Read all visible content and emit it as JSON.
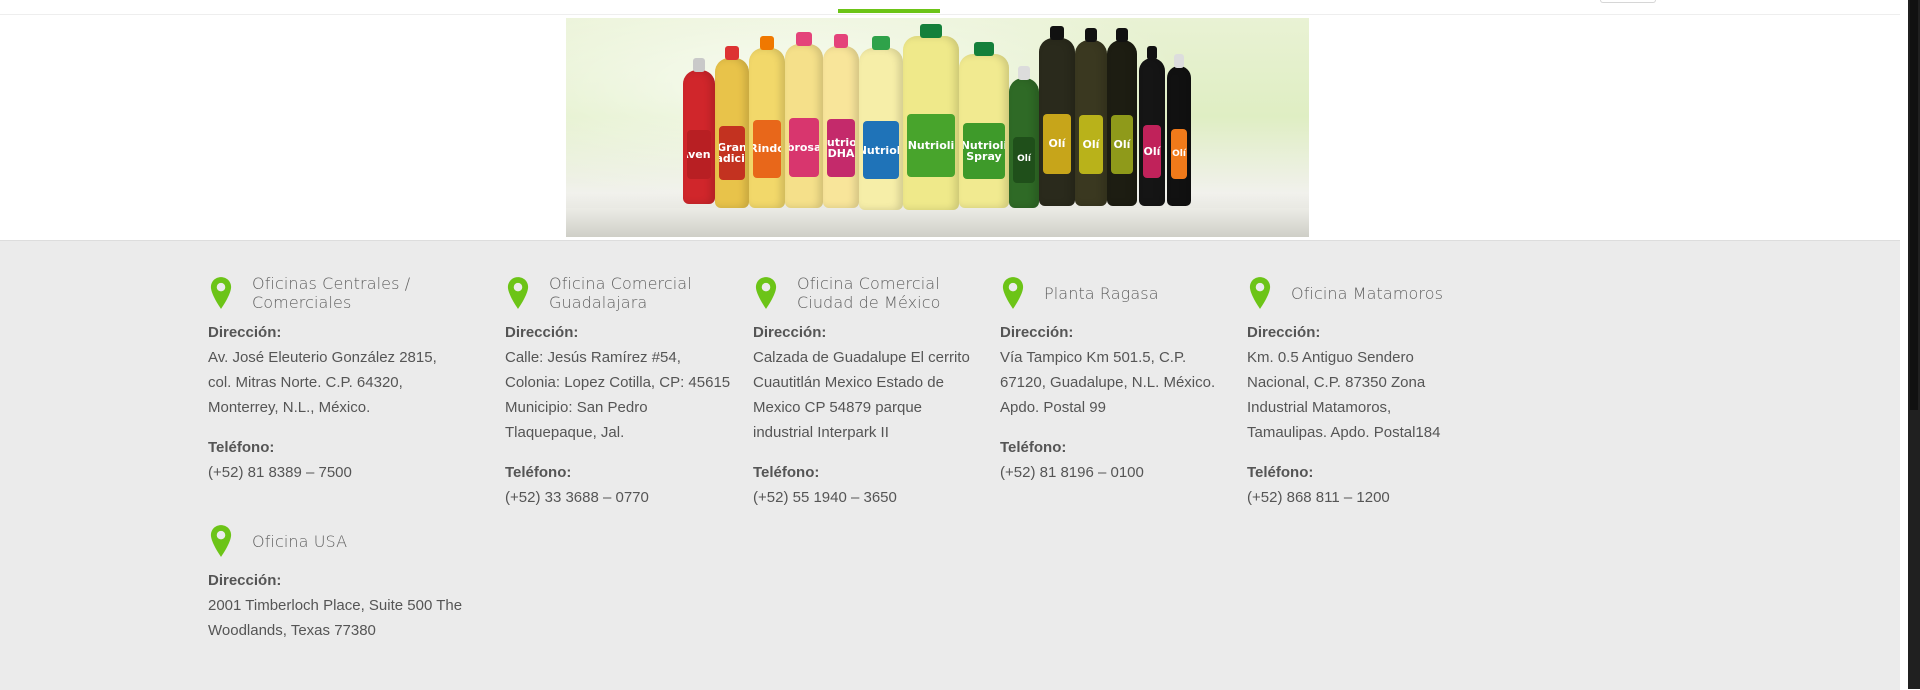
{
  "brand": {
    "accent": "#6cc417"
  },
  "hero": {
    "products": [
      "Avena",
      "Gran Tradición",
      "Rindo",
      "Sabrosano",
      "Nutrioli DHA",
      "Nutrioli",
      "Nutrioli",
      "Nutrioli Spray",
      "Olí",
      "Olí",
      "Olí",
      "Olí",
      "Olí",
      "Olí"
    ]
  },
  "offices": [
    {
      "title": "Oficinas Centrales / Comerciales",
      "address_label": "Dirección:",
      "address": "Av. José Eleuterio González 2815, col. Mitras Norte. C.P. 64320, Monterrey, N.L., México.",
      "phone_label": "Teléfono:",
      "phone": "(+52) 81 8389 – 7500"
    },
    {
      "title": "Oficina Comercial Guadalajara",
      "address_label": "Dirección:",
      "address": "Calle: Jesús Ramírez #54, Colonia: Lopez Cotilla, CP: 45615 Municipio: San Pedro Tlaquepaque, Jal.",
      "phone_label": "Teléfono:",
      "phone": "(+52) 33 3688 – 0770"
    },
    {
      "title": "Oficina Comercial Ciudad de México",
      "address_label": "Dirección:",
      "address": "Calzada de Guadalupe El cerrito Cuautitlán Mexico Estado de Mexico CP 54879 parque industrial Interpark II",
      "phone_label": "Teléfono:",
      "phone": "(+52) 55 1940 – 3650"
    },
    {
      "title": "Planta Ragasa",
      "address_label": "Dirección:",
      "address": "Vía Tampico Km 501.5, C.P. 67120, Guadalupe, N.L. México. Apdo. Postal 99",
      "phone_label": "Teléfono:",
      "phone": "(+52) 81 8196 – 0100"
    },
    {
      "title": "Oficina Matamoros",
      "address_label": "Dirección:",
      "address": "Km. 0.5 Antiguo Sendero Nacional, C.P. 87350 Zona Industrial Matamoros, Tamaulipas. Apdo. Postal184",
      "phone_label": "Teléfono:",
      "phone": "(+52) 868 811 – 1200"
    },
    {
      "title": "Oficina USA",
      "address_label": "Dirección:",
      "address": "2001 Timberloch Place, Suite 500 The Woodlands, Texas 77380"
    }
  ]
}
